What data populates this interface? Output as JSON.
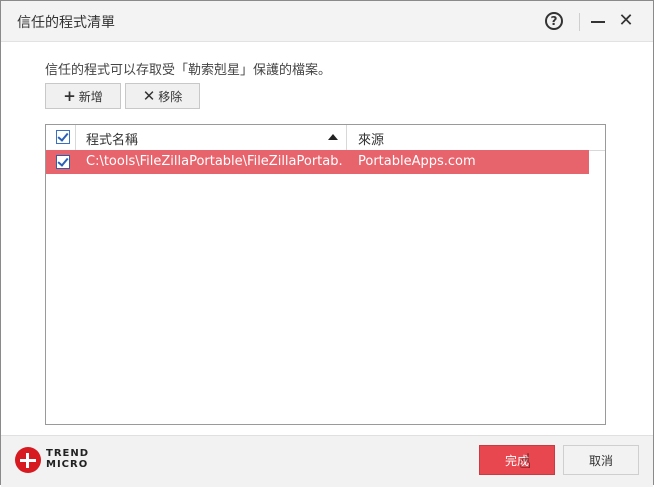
{
  "window": {
    "title": "信任的程式清單",
    "help_glyph": "?",
    "close_glyph": "✕"
  },
  "main": {
    "description": "信任的程式可以存取受「勒索剋星」保護的檔案。",
    "add_button": {
      "icon": "plus-icon",
      "glyph": "+",
      "label": "新增"
    },
    "remove_button": {
      "icon": "x-icon",
      "glyph": "✕",
      "label": "移除"
    }
  },
  "table": {
    "columns": [
      {
        "label": "程式名稱",
        "sort": "ascending"
      },
      {
        "label": "來源"
      }
    ],
    "header_checked": true,
    "rows": [
      {
        "checked": true,
        "selected": true,
        "path": "C:\\tools\\FileZillaPortable\\FileZillaPortab...",
        "source": "PortableApps.com"
      }
    ]
  },
  "footer": {
    "logo_line1": "TREND",
    "logo_line2": "MICRO",
    "done_label": "完成",
    "cancel_label": "取消"
  },
  "colors": {
    "selected_row": "#e8646d",
    "primary_button": "#e8474f",
    "brand_red": "#d71920"
  }
}
